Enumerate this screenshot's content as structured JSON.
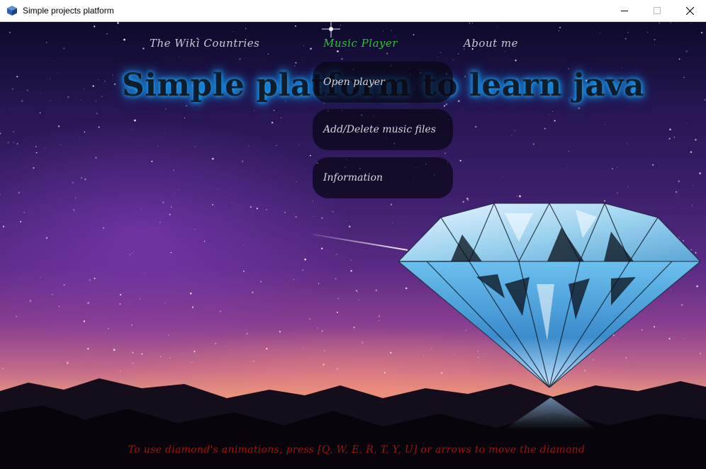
{
  "window": {
    "title": "Simple projects platform",
    "icon": "cube-app-icon",
    "controls": [
      "minimize",
      "maximize",
      "close"
    ]
  },
  "nav": {
    "wiki": "The Wiki Countries",
    "music": "Music Player",
    "about": "About me"
  },
  "heading": "Simple platform to learn java",
  "dropdown": {
    "open_player": "Open player",
    "add_delete": "Add/Delete music files",
    "information": "Information"
  },
  "hint": "To use diamond's animations, press [Q, W, E, R, T, Y, U] or arrows to move the diamond",
  "colors": {
    "active_nav": "#29c52f",
    "nav": "#c9c9d2",
    "heading_glow": "#1ea7ff",
    "hint": "#a1130e"
  }
}
